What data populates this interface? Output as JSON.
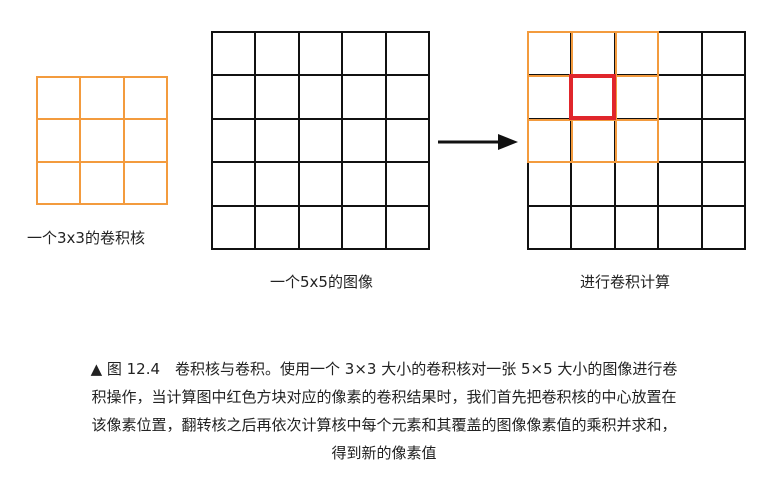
{
  "colors": {
    "kernel": "#f39b3e",
    "grid": "#111111",
    "highlight": "#e0262b"
  },
  "captions": {
    "kernel": "一个3x3的卷积核",
    "image": "一个5x5的图像",
    "result": "进行卷积计算"
  },
  "figure_caption": {
    "line1": "▲ 图 12.4　卷积核与卷积。使用一个 3×3 大小的卷积核对一张 5×5 大小的图像进行卷",
    "line2": "积操作，当计算图中红色方块对应的像素的卷积结果时，我们首先把卷积核的中心放置在",
    "line3": "该像素位置，翻转核之后再依次计算核中每个元素和其覆盖的图像像素值的乘积并求和，",
    "line4": "得到新的像素值"
  },
  "icons": {
    "arrow": "arrow-right-icon"
  }
}
